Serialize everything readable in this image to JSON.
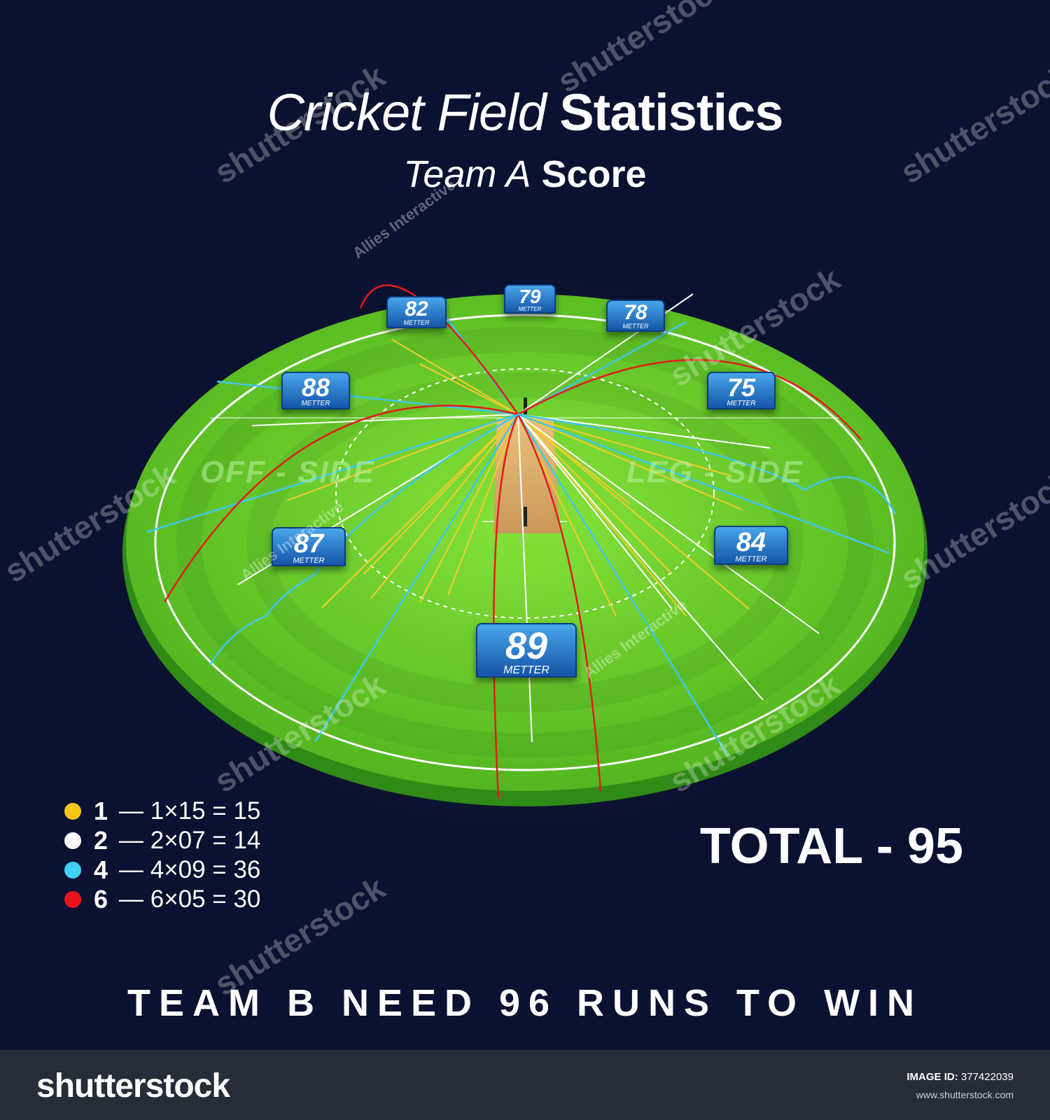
{
  "header": {
    "title_light": "Cricket Field",
    "title_bold": "Statistics",
    "subtitle_light": "Team A",
    "subtitle_bold": "Score"
  },
  "field": {
    "off_side_label": "OFF - SIDE",
    "leg_side_label": "LEG - SIDE",
    "distance_unit": "METTER",
    "distances": [
      {
        "value": "82"
      },
      {
        "value": "79"
      },
      {
        "value": "78"
      },
      {
        "value": "88"
      },
      {
        "value": "75"
      },
      {
        "value": "87"
      },
      {
        "value": "84"
      },
      {
        "value": "89"
      }
    ],
    "shot_colors": {
      "1": "#f2cc2e",
      "2": "#ffffff",
      "4": "#3fc7ea",
      "6": "#e21b1b"
    }
  },
  "legend": [
    {
      "runs": "1",
      "equation": "— 1×15 = 15",
      "color": "#f5c518"
    },
    {
      "runs": "2",
      "equation": "— 2×07 = 14",
      "color": "#ffffff"
    },
    {
      "runs": "4",
      "equation": "— 4×09 = 36",
      "color": "#3fd0f5"
    },
    {
      "runs": "6",
      "equation": "— 6×05 = 30",
      "color": "#e8141b"
    }
  ],
  "total": "TOTAL - 95",
  "need_message": "TEAM B NEED 96 RUNS TO WIN",
  "watermarks": {
    "stock": "shutterstock",
    "author": "Allies Interactive"
  },
  "footer": {
    "logo": "shutterstock",
    "image_id_label": "IMAGE ID:",
    "image_id": "377422039",
    "site": "www.shutterstock.com"
  }
}
